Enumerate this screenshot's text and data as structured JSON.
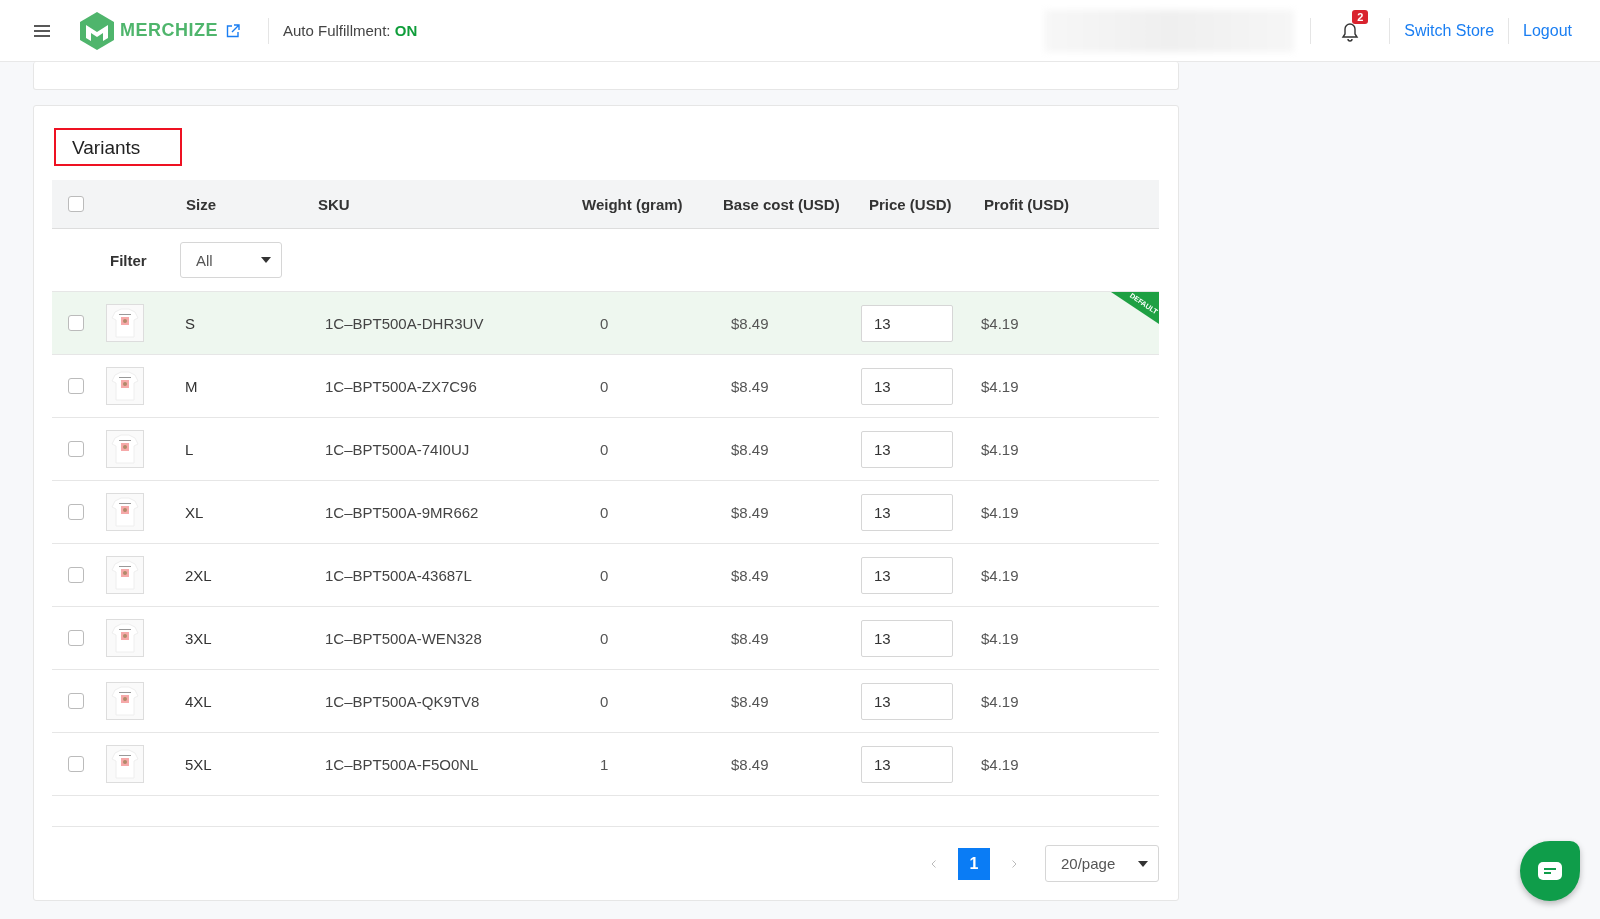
{
  "header": {
    "brand": "MERCHIZE",
    "auto_fulfillment_label": "Auto Fulfillment:",
    "auto_fulfillment_value": "ON",
    "auto_fulfillment_on": true,
    "notification_count": "2",
    "links": [
      "Switch Store",
      "Logout"
    ]
  },
  "variants": {
    "title": "Variants",
    "all_checked": false,
    "columns": [
      "Size",
      "SKU",
      "Weight (gram)",
      "Base cost (USD)",
      "Price (USD)",
      "Profit (USD)"
    ],
    "filter": {
      "label": "Filter",
      "value": "All"
    },
    "rows": [
      {
        "checked": false,
        "default": true,
        "default_label": "DEFAULT",
        "size": "S",
        "sku": "1C–BPT500A-DHR3UV",
        "weight": "0",
        "base_cost": "$8.49",
        "price": "13",
        "profit": "$4.19"
      },
      {
        "checked": false,
        "default": false,
        "size": "M",
        "sku": "1C–BPT500A-ZX7C96",
        "weight": "0",
        "base_cost": "$8.49",
        "price": "13",
        "profit": "$4.19"
      },
      {
        "checked": false,
        "default": false,
        "size": "L",
        "sku": "1C–BPT500A-74I0UJ",
        "weight": "0",
        "base_cost": "$8.49",
        "price": "13",
        "profit": "$4.19"
      },
      {
        "checked": false,
        "default": false,
        "size": "XL",
        "sku": "1C–BPT500A-9MR662",
        "weight": "0",
        "base_cost": "$8.49",
        "price": "13",
        "profit": "$4.19"
      },
      {
        "checked": false,
        "default": false,
        "size": "2XL",
        "sku": "1C–BPT500A-43687L",
        "weight": "0",
        "base_cost": "$8.49",
        "price": "13",
        "profit": "$4.19"
      },
      {
        "checked": false,
        "default": false,
        "size": "3XL",
        "sku": "1C–BPT500A-WEN328",
        "weight": "0",
        "base_cost": "$8.49",
        "price": "13",
        "profit": "$4.19"
      },
      {
        "checked": false,
        "default": false,
        "size": "4XL",
        "sku": "1C–BPT500A-QK9TV8",
        "weight": "0",
        "base_cost": "$8.49",
        "price": "13",
        "profit": "$4.19"
      },
      {
        "checked": false,
        "default": false,
        "size": "5XL",
        "sku": "1C–BPT500A-F5O0NL",
        "weight": "1",
        "base_cost": "$8.49",
        "price": "13",
        "profit": "$4.19"
      }
    ],
    "pagination": {
      "pages": [
        {
          "label": "1",
          "selected": true
        }
      ],
      "page_size": "20/page"
    }
  }
}
